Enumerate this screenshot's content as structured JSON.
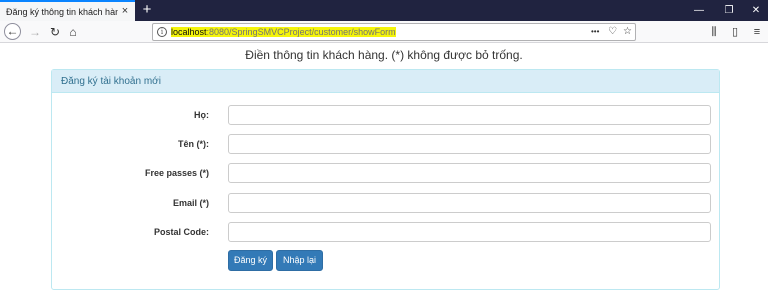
{
  "browser": {
    "tab_title": "Đăng ký thông tin khách hàng",
    "tab_close": "×",
    "new_tab": "+",
    "url_host": "localhost",
    "url_path": ":8080/SpringSMVCProject/customer/showForm",
    "url_more": "•••",
    "window_minimize": "—",
    "window_restore": "❐",
    "window_close": "✕"
  },
  "page": {
    "heading": "Điền thông tin khách hàng. (*) không được bỏ trống.",
    "panel_title": "Đăng ký tài khoản mới",
    "fields": [
      {
        "label": "Họ:",
        "value": ""
      },
      {
        "label": "Tên (*):",
        "value": ""
      },
      {
        "label": "Free passes (*)",
        "value": ""
      },
      {
        "label": "Email (*)",
        "value": ""
      },
      {
        "label": "Postal Code:",
        "value": ""
      }
    ],
    "submit_label": "Đăng ký",
    "reset_label": "Nhập lại"
  },
  "colors": {
    "panel_heading_bg": "#d9edf7",
    "panel_heading_text": "#31708f",
    "button_primary": "#337ab7",
    "url_highlight": "#f4f40b"
  }
}
